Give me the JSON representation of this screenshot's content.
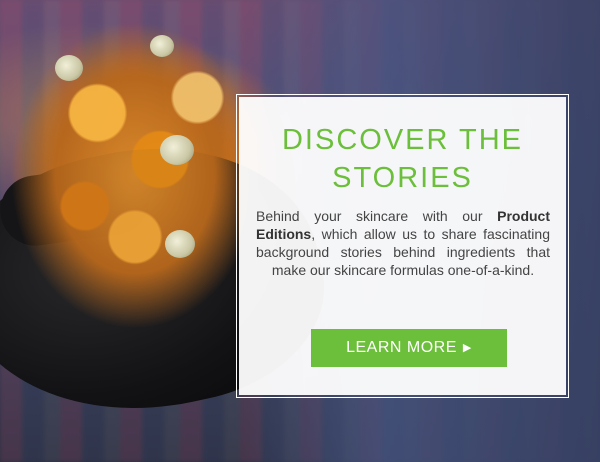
{
  "hero": {
    "title_line1": "DISCOVER THE",
    "title_line2": "STORIES",
    "body": {
      "intro": "Behind your skincare with our",
      "bold": "Product Editions",
      "rest": ", which allow us to share fascinating background stories behind ingredients that make our skincare formulas one-of-a-kind."
    },
    "cta_label": "LEARN MORE",
    "cta_icon": "triangle-right-icon",
    "accent_color": "#6cbf3a"
  }
}
